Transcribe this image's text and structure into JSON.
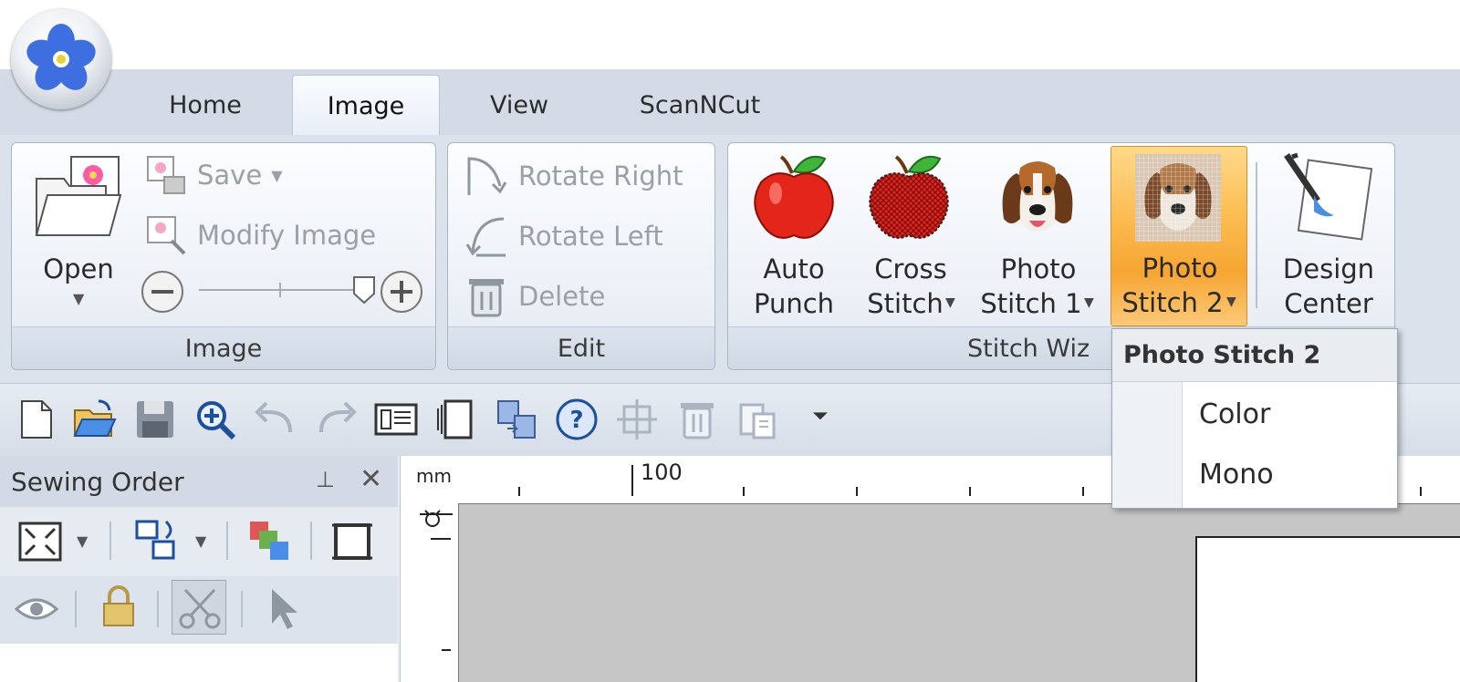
{
  "tabs": [
    {
      "label": "Home",
      "active": false
    },
    {
      "label": "Image",
      "active": true
    },
    {
      "label": "View",
      "active": false
    },
    {
      "label": "ScanNCut",
      "active": false
    }
  ],
  "ribbon": {
    "image_group": {
      "label": "Image",
      "open": "Open",
      "save": "Save",
      "modify_image": "Modify Image"
    },
    "edit_group": {
      "label": "Edit",
      "rotate_right": "Rotate Right",
      "rotate_left": "Rotate Left",
      "delete": "Delete"
    },
    "stitch_group": {
      "label": "Stitch Wiz",
      "auto_punch": [
        "Auto",
        "Punch"
      ],
      "cross_stitch": [
        "Cross",
        "Stitch"
      ],
      "photo_stitch_1": [
        "Photo",
        "Stitch 1"
      ],
      "photo_stitch_2": [
        "Photo",
        "Stitch 2"
      ],
      "design_center": [
        "Design",
        "Center"
      ]
    }
  },
  "dropdown": {
    "header": "Photo Stitch 2",
    "items": [
      "Color",
      "Mono"
    ]
  },
  "sewing_panel": {
    "title": "Sewing Order"
  },
  "ruler": {
    "unit": "mm",
    "mark": "100"
  },
  "colors": {
    "accent_orange": "#f6a532",
    "ribbon_bg": "#dce2eb"
  }
}
